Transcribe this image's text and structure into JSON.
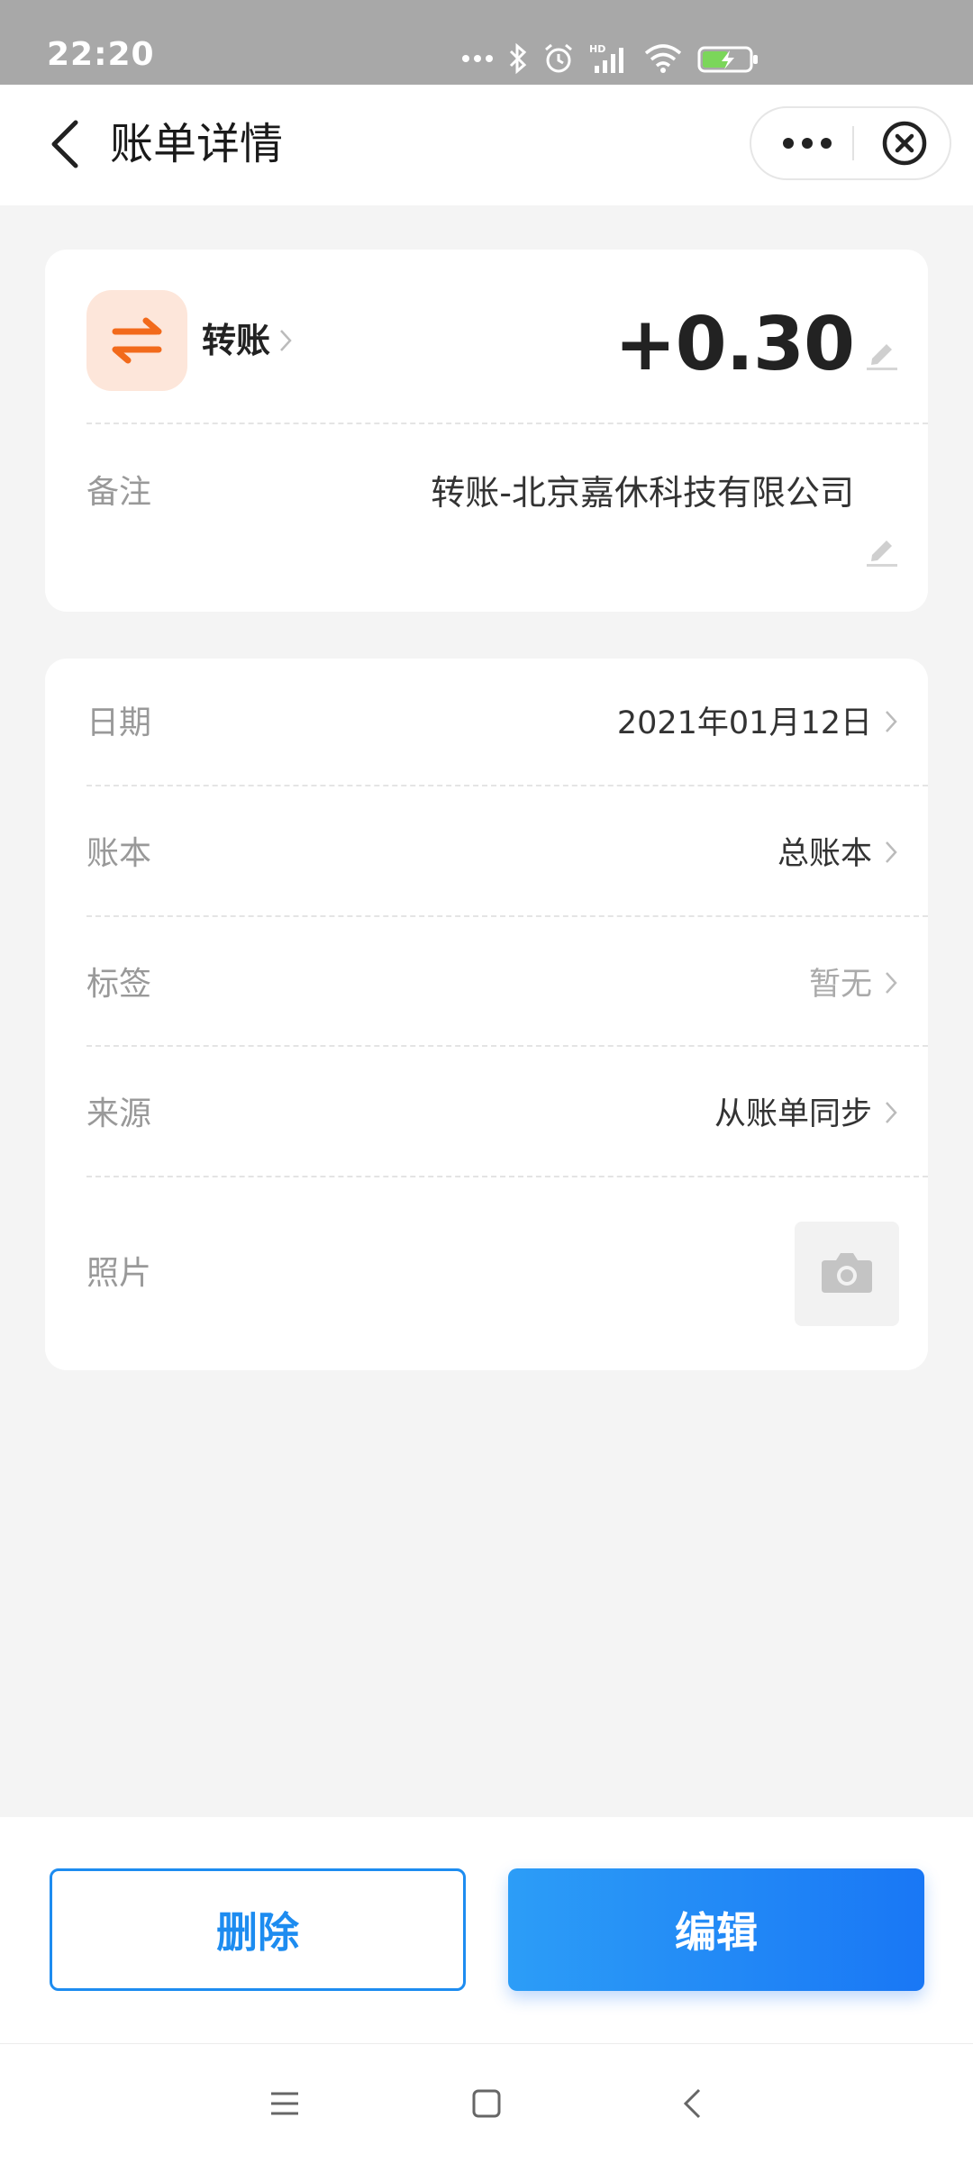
{
  "status_bar": {
    "time": "22:20",
    "icons": [
      "more-dots-icon",
      "bluetooth-icon",
      "alarm-icon",
      "signal-hd-icon",
      "wifi-icon",
      "battery-charging-icon"
    ]
  },
  "nav": {
    "title": "账单详情",
    "back_icon": "chevron-left-icon",
    "more_icon": "more-dots-icon",
    "close_icon": "close-circle-icon"
  },
  "record": {
    "category_icon": "transfer-arrows-icon",
    "category": "转账",
    "amount": "+0.30",
    "note_label": "备注",
    "note_value": "转账-北京嘉休科技有限公司"
  },
  "details": {
    "rows": [
      {
        "label": "日期",
        "value": "2021年01月12日"
      },
      {
        "label": "账本",
        "value": "总账本"
      },
      {
        "label": "标签",
        "value": "暂无"
      },
      {
        "label": "来源",
        "value": "从账单同步"
      }
    ],
    "photo_label": "照片",
    "photo_icon": "camera-icon"
  },
  "actions": {
    "delete_label": "删除",
    "edit_label": "编辑"
  },
  "system_nav": {
    "icons": [
      "menu-icon",
      "home-square-icon",
      "back-icon"
    ]
  },
  "colors": {
    "accent": "#1d8cf0",
    "category_accent": "#f26a1b",
    "category_bg": "#fde6da",
    "page_bg": "#f4f4f4",
    "status_bar_bg": "#a8a8a8"
  }
}
